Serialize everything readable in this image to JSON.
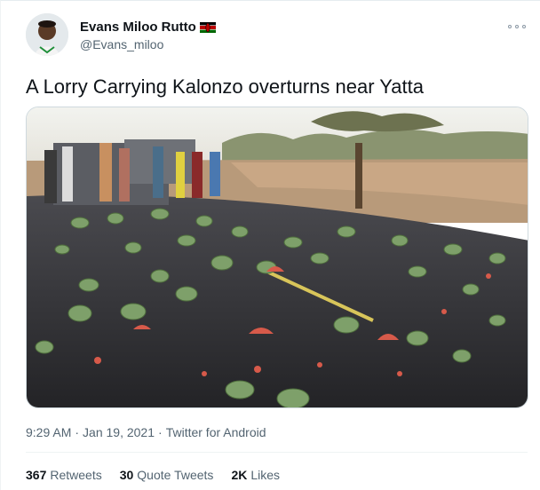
{
  "user": {
    "display_name": "Evans Miloo Rutto",
    "handle": "@Evans_miloo",
    "flag_icon": "kenya-flag-icon"
  },
  "tweet": {
    "text": "A Lorry Carrying Kalonzo overturns near Yatta",
    "time": "9:29 AM",
    "date": "Jan 19, 2021",
    "source": "Twitter for Android",
    "sep": "·"
  },
  "stats": {
    "retweets_count": "367",
    "retweets_label": "Retweets",
    "quotes_count": "30",
    "quotes_label": "Quote Tweets",
    "likes_count": "2K",
    "likes_label": "Likes"
  },
  "colors": {
    "text_primary": "#0f1419",
    "text_secondary": "#536471",
    "border": "#eff3f4"
  }
}
